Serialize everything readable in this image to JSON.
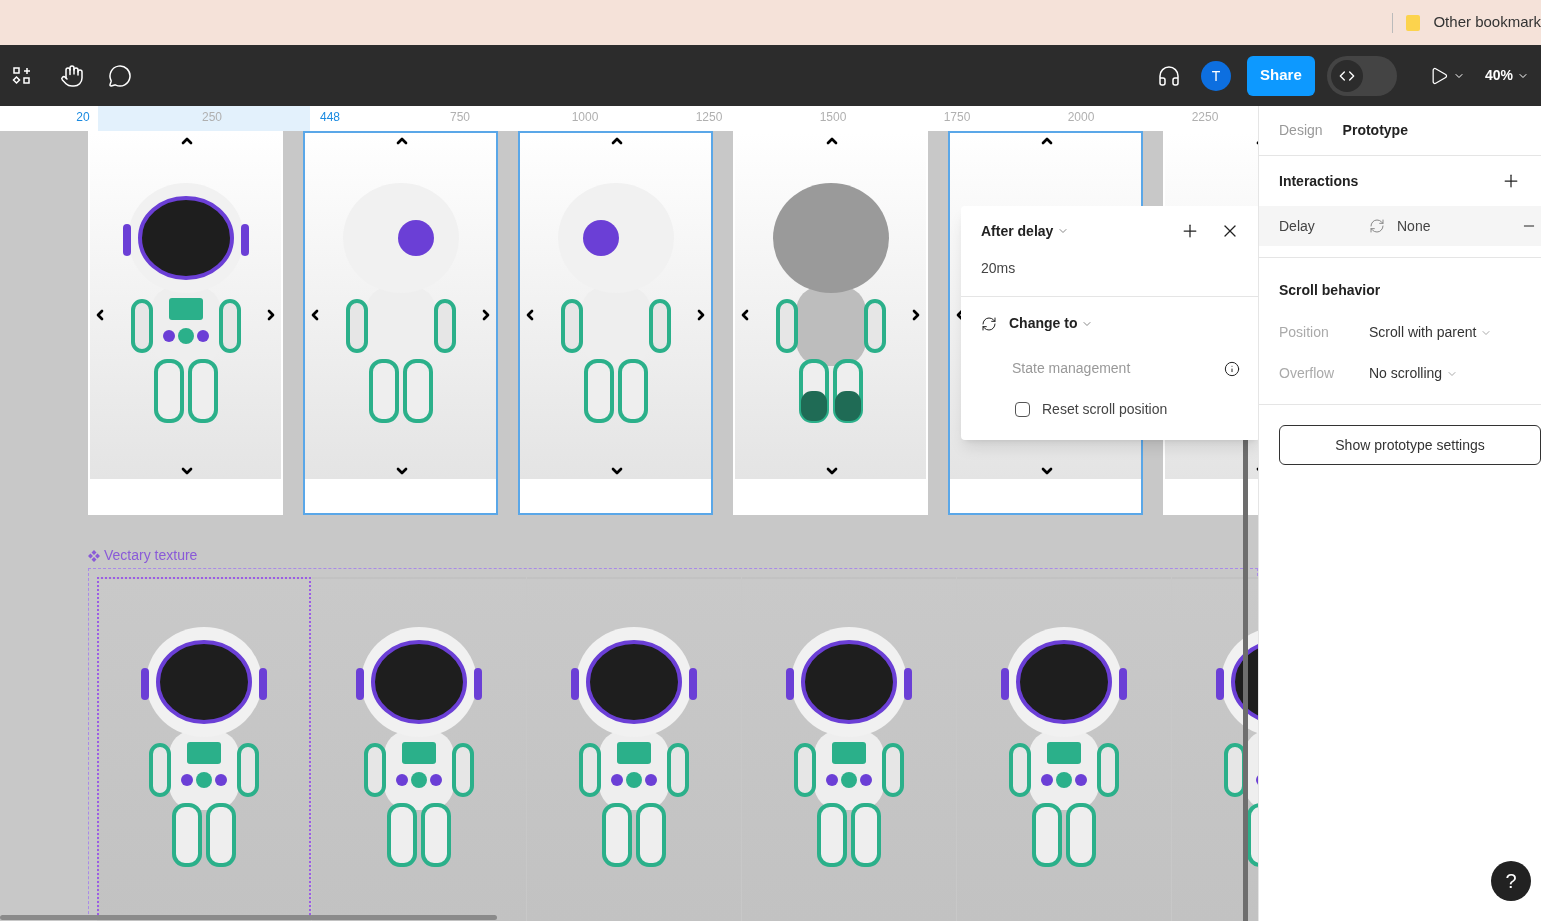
{
  "browser": {
    "bookmark": "Other bookmark"
  },
  "toolbar": {
    "share": "Share",
    "avatar": "T",
    "zoom": "40%",
    "dev_mode": {
      "on": false
    }
  },
  "ruler": [
    {
      "label": "20",
      "selected": true
    },
    {
      "label": "250",
      "selected": false
    },
    {
      "label": "448",
      "selected": true
    },
    {
      "label": "750",
      "selected": false
    },
    {
      "label": "1000",
      "selected": false
    },
    {
      "label": "1250",
      "selected": false
    },
    {
      "label": "1500",
      "selected": false
    },
    {
      "label": "1750",
      "selected": false
    },
    {
      "label": "2000",
      "selected": false
    },
    {
      "label": "2250",
      "selected": false
    }
  ],
  "frames": [
    {
      "kind": "front",
      "selected": false,
      "side_arrows": true,
      "right_arrow": true
    },
    {
      "kind": "left",
      "selected": true,
      "side_arrows": true,
      "right_arrow": true
    },
    {
      "kind": "right",
      "selected": true,
      "side_arrows": true,
      "right_arrow": true
    },
    {
      "kind": "back",
      "selected": false,
      "side_arrows": true,
      "right_arrow": true
    },
    {
      "kind": "empty",
      "selected": true,
      "side_arrows": true,
      "right_arrow": false
    },
    {
      "kind": "empty",
      "selected": false
    }
  ],
  "component": {
    "name": "Vectary texture",
    "instances": [
      {
        "selected": true
      },
      {
        "selected": false
      },
      {
        "selected": false
      },
      {
        "selected": false
      },
      {
        "selected": false
      },
      {
        "selected": false
      }
    ]
  },
  "popup": {
    "trigger": "After delay",
    "delay": "20ms",
    "action": "Change to",
    "section": "State management",
    "option": {
      "label": "Reset scroll position",
      "checked": false
    }
  },
  "panel": {
    "tabs": [
      {
        "label": "Design",
        "selected": false
      },
      {
        "label": "Prototype",
        "selected": true
      }
    ],
    "interactions": {
      "title": "Interactions",
      "trigger": "Delay",
      "value": "None"
    },
    "scroll": {
      "title": "Scroll behavior",
      "rows": [
        {
          "label": "Position",
          "value": "Scroll with parent"
        },
        {
          "label": "Overflow",
          "value": "No scrolling"
        }
      ]
    },
    "button": "Show prototype settings",
    "help": "?"
  }
}
